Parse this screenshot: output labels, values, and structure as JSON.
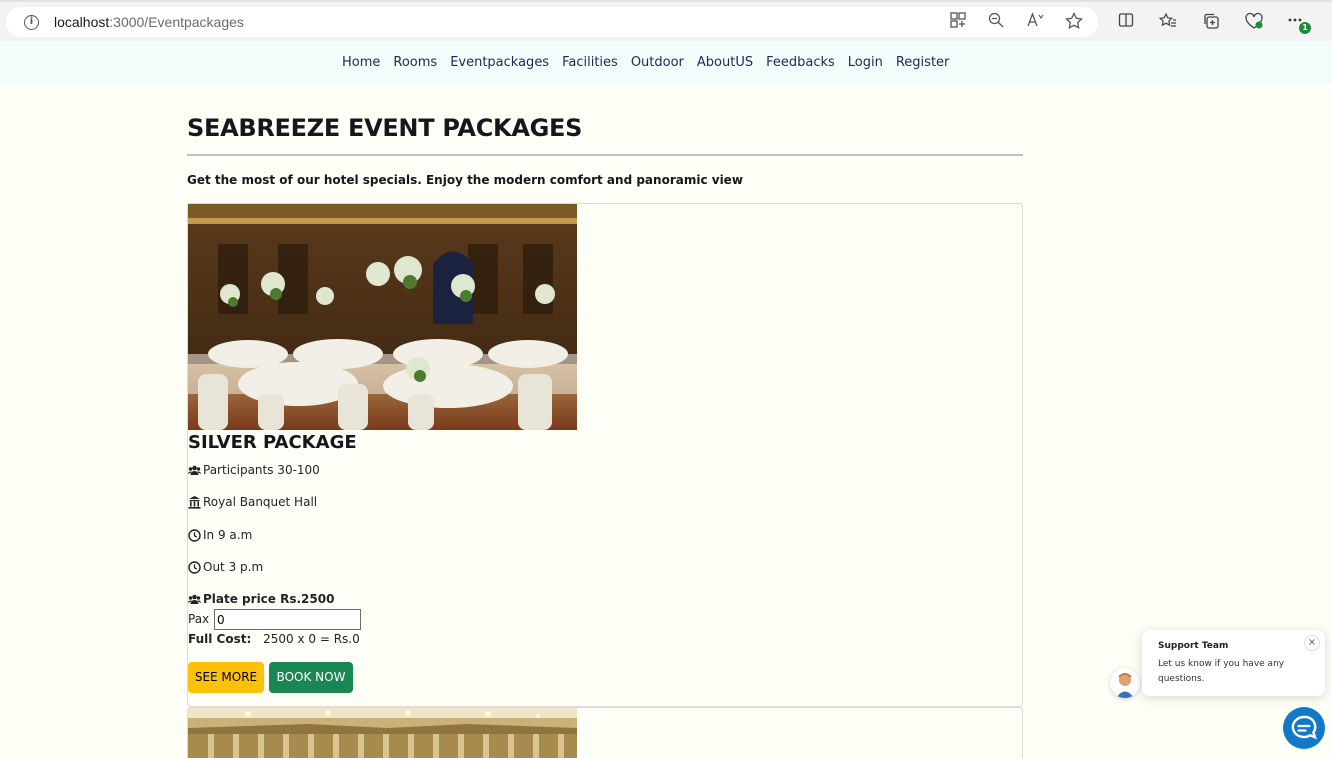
{
  "browser": {
    "url_host": "localhost",
    "url_path": ":3000/Eventpackages",
    "extension_badge": "1"
  },
  "nav": {
    "items": [
      "Home",
      "Rooms",
      "Eventpackages",
      "Facilities",
      "Outdoor",
      "AboutUS",
      "Feedbacks",
      "Login",
      "Register"
    ]
  },
  "page": {
    "title": "SEABREEZE EVENT PACKAGES",
    "tagline": "Get the most of our hotel specials. Enjoy the modern comfort and panoramic view"
  },
  "package": {
    "name": "SILVER PACKAGE",
    "participants": "Participants 30-100",
    "venue": "Royal Banquet Hall",
    "check_in": "In 9 a.m",
    "check_out": "Out 3 p.m",
    "plate_price": "Plate price Rs.2500",
    "pax_label": "Pax",
    "pax_value": "0",
    "full_cost_label": "Full Cost:",
    "full_cost_value": "2500 x 0 = Rs.0",
    "see_more": "SEE MORE",
    "book_now": "BOOK NOW"
  },
  "chat": {
    "title": "Support Team",
    "message": "Let us know if you have any questions.",
    "close": "×"
  },
  "colors": {
    "see_more_bg": "#ffc107",
    "book_now_bg": "#198754",
    "nav_bg": "#f1fcfb",
    "page_bg": "#fdfef5",
    "chat_launcher": "#1279c9"
  }
}
